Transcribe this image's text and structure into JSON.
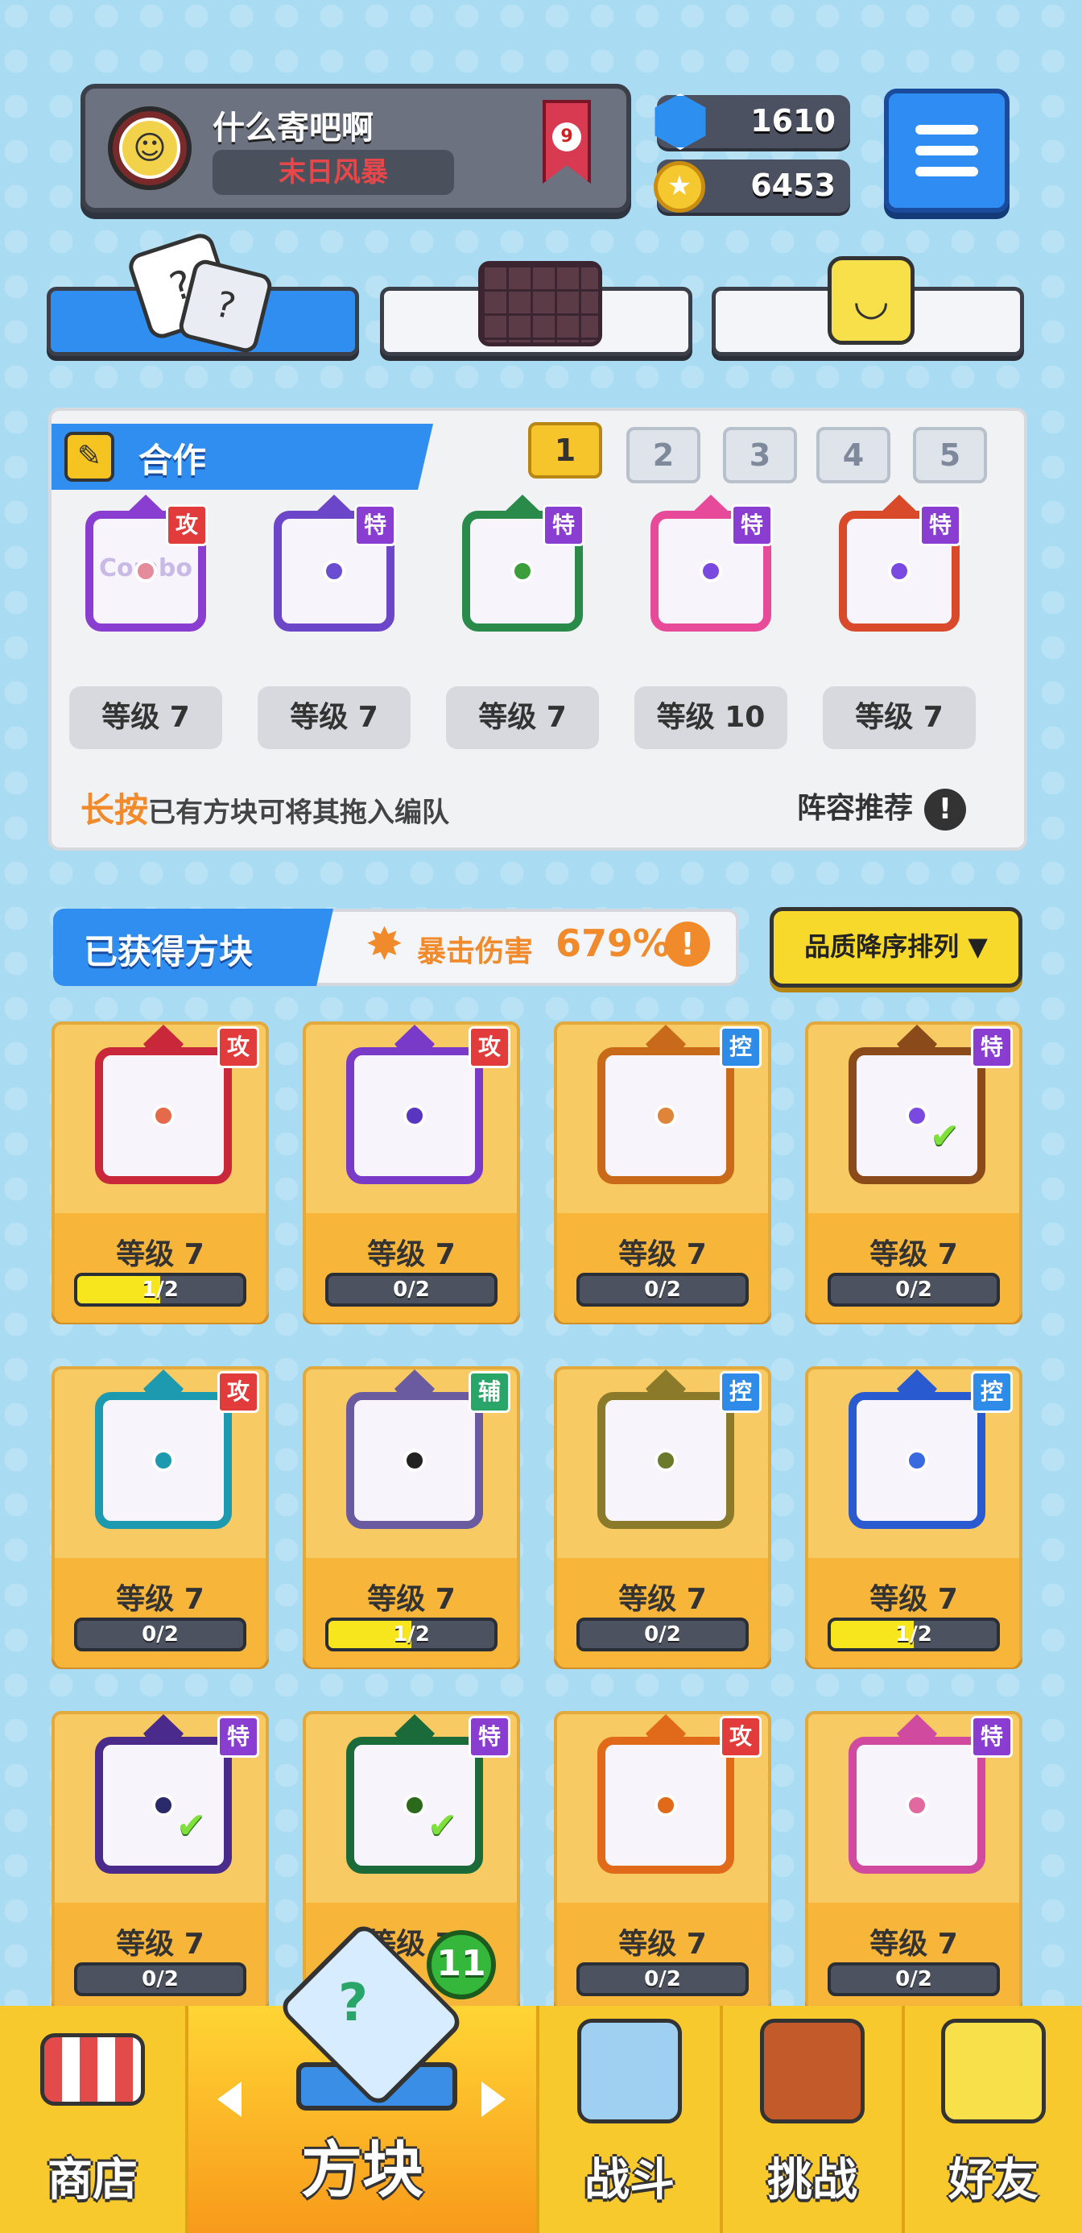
{
  "header": {
    "player_name": "什么寄吧啊",
    "player_title": "末日风暴",
    "rank_number": "9",
    "gems": "1610",
    "coins": "6453"
  },
  "tabs": [
    {
      "name": "dice",
      "icon": "dice-icon"
    },
    {
      "name": "board",
      "icon": "grid-icon"
    },
    {
      "name": "emoji",
      "icon": "smile-face-icon"
    }
  ],
  "coop": {
    "title": "合作",
    "pages": [
      "1",
      "2",
      "3",
      "4",
      "5"
    ],
    "active_page": "1",
    "team": [
      {
        "level": "等级 7",
        "badge": "攻",
        "badge_type": "atk",
        "frame_color": "#8a3ed1",
        "dot_color": "#e58b9a",
        "art": "Combo"
      },
      {
        "level": "等级 7",
        "badge": "特",
        "badge_type": "spc",
        "frame_color": "#6c46c8",
        "dot_color": "#6a4dd0",
        "art": ""
      },
      {
        "level": "等级 7",
        "badge": "特",
        "badge_type": "spc",
        "frame_color": "#2a8a4a",
        "dot_color": "#3b9e3b",
        "art": ""
      },
      {
        "level": "等级 10",
        "badge": "特",
        "badge_type": "spc",
        "frame_color": "#e84a9a",
        "dot_color": "#7a4ae0",
        "art": ""
      },
      {
        "level": "等级 7",
        "badge": "特",
        "badge_type": "spc",
        "frame_color": "#d84a2a",
        "dot_color": "#7a4ae0",
        "art": ""
      }
    ],
    "hint_highlight": "长按",
    "hint_rest": "已有方块可将其拖入编队",
    "lineup_recommend": "阵容推荐",
    "info_symbol": "!"
  },
  "owned": {
    "title": "已获得方块",
    "crit_label": "暴击伤害",
    "crit_value": "679%",
    "info_symbol": "!",
    "sort_label": "品质降序排列 ▼",
    "blocks": [
      {
        "level": "等级 7",
        "progress": "1/2",
        "fill": 0.5,
        "badge": "攻",
        "badge_type": "atk",
        "frame_color": "#c8283a",
        "dot_color": "#e56a4a",
        "check": false
      },
      {
        "level": "等级 7",
        "progress": "0/2",
        "fill": 0,
        "badge": "攻",
        "badge_type": "atk",
        "frame_color": "#7a3ac8",
        "dot_color": "#5a36c0",
        "check": false
      },
      {
        "level": "等级 7",
        "progress": "0/2",
        "fill": 0,
        "badge": "控",
        "badge_type": "ctl",
        "frame_color": "#c86a1a",
        "dot_color": "#e0843a",
        "check": false
      },
      {
        "level": "等级 7",
        "progress": "0/2",
        "fill": 0,
        "badge": "特",
        "badge_type": "spc",
        "frame_color": "#8a4a1a",
        "dot_color": "#7a4ae0",
        "check": true
      },
      {
        "level": "等级 7",
        "progress": "0/2",
        "fill": 0,
        "badge": "攻",
        "badge_type": "atk",
        "frame_color": "#1e9ab0",
        "dot_color": "#1e9ab0",
        "check": false
      },
      {
        "level": "等级 7",
        "progress": "1/2",
        "fill": 0.5,
        "badge": "辅",
        "badge_type": "sup",
        "frame_color": "#6a5aa0",
        "dot_color": "#222222",
        "check": false
      },
      {
        "level": "等级 7",
        "progress": "0/2",
        "fill": 0,
        "badge": "控",
        "badge_type": "ctl",
        "frame_color": "#8a7a2a",
        "dot_color": "#6a7a2a",
        "check": false
      },
      {
        "level": "等级 7",
        "progress": "1/2",
        "fill": 0.5,
        "badge": "控",
        "badge_type": "ctl",
        "frame_color": "#2a5ad0",
        "dot_color": "#3a6ae0",
        "check": false
      },
      {
        "level": "等级 7",
        "progress": "0/2",
        "fill": 0,
        "badge": "特",
        "badge_type": "spc",
        "frame_color": "#4a2a8a",
        "dot_color": "#2a2a6a",
        "check": true
      },
      {
        "level": "等级 7",
        "progress": "",
        "fill": 0,
        "badge": "特",
        "badge_type": "spc",
        "frame_color": "#1a6a3a",
        "dot_color": "#2a6a1a",
        "check": true
      },
      {
        "level": "等级 7",
        "progress": "0/2",
        "fill": 0,
        "badge": "攻",
        "badge_type": "atk",
        "frame_color": "#e06a1a",
        "dot_color": "#e06a1a",
        "check": false
      },
      {
        "level": "等级 7",
        "progress": "0/2",
        "fill": 0,
        "badge": "特",
        "badge_type": "spc",
        "frame_color": "#d04aa0",
        "dot_color": "#e06aa0",
        "check": false
      }
    ]
  },
  "nav": {
    "shop": "商店",
    "blocks": "方块",
    "battle": "战斗",
    "challenge": "挑战",
    "friends": "好友",
    "blocks_badge": "11"
  },
  "colors": {
    "accent_blue": "#2f8eef",
    "gold": "#f7c92c",
    "orange": "#f08a2a"
  }
}
